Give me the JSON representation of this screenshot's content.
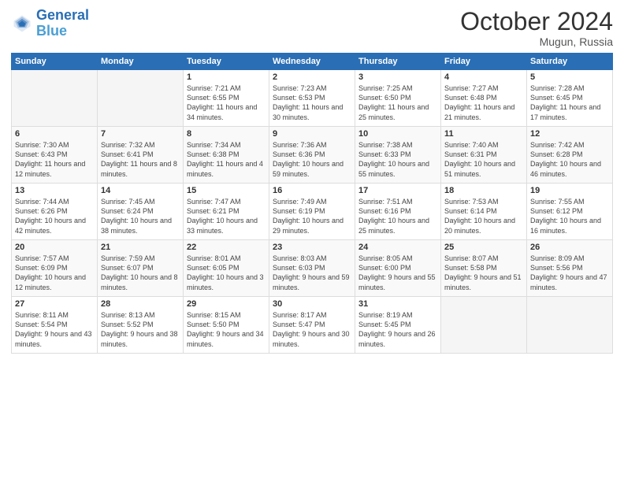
{
  "header": {
    "logo_line1": "General",
    "logo_line2": "Blue",
    "month": "October 2024",
    "location": "Mugun, Russia"
  },
  "weekdays": [
    "Sunday",
    "Monday",
    "Tuesday",
    "Wednesday",
    "Thursday",
    "Friday",
    "Saturday"
  ],
  "weeks": [
    [
      {
        "day": "",
        "sunrise": "",
        "sunset": "",
        "daylight": ""
      },
      {
        "day": "",
        "sunrise": "",
        "sunset": "",
        "daylight": ""
      },
      {
        "day": "1",
        "sunrise": "Sunrise: 7:21 AM",
        "sunset": "Sunset: 6:55 PM",
        "daylight": "Daylight: 11 hours and 34 minutes."
      },
      {
        "day": "2",
        "sunrise": "Sunrise: 7:23 AM",
        "sunset": "Sunset: 6:53 PM",
        "daylight": "Daylight: 11 hours and 30 minutes."
      },
      {
        "day": "3",
        "sunrise": "Sunrise: 7:25 AM",
        "sunset": "Sunset: 6:50 PM",
        "daylight": "Daylight: 11 hours and 25 minutes."
      },
      {
        "day": "4",
        "sunrise": "Sunrise: 7:27 AM",
        "sunset": "Sunset: 6:48 PM",
        "daylight": "Daylight: 11 hours and 21 minutes."
      },
      {
        "day": "5",
        "sunrise": "Sunrise: 7:28 AM",
        "sunset": "Sunset: 6:45 PM",
        "daylight": "Daylight: 11 hours and 17 minutes."
      }
    ],
    [
      {
        "day": "6",
        "sunrise": "Sunrise: 7:30 AM",
        "sunset": "Sunset: 6:43 PM",
        "daylight": "Daylight: 11 hours and 12 minutes."
      },
      {
        "day": "7",
        "sunrise": "Sunrise: 7:32 AM",
        "sunset": "Sunset: 6:41 PM",
        "daylight": "Daylight: 11 hours and 8 minutes."
      },
      {
        "day": "8",
        "sunrise": "Sunrise: 7:34 AM",
        "sunset": "Sunset: 6:38 PM",
        "daylight": "Daylight: 11 hours and 4 minutes."
      },
      {
        "day": "9",
        "sunrise": "Sunrise: 7:36 AM",
        "sunset": "Sunset: 6:36 PM",
        "daylight": "Daylight: 10 hours and 59 minutes."
      },
      {
        "day": "10",
        "sunrise": "Sunrise: 7:38 AM",
        "sunset": "Sunset: 6:33 PM",
        "daylight": "Daylight: 10 hours and 55 minutes."
      },
      {
        "day": "11",
        "sunrise": "Sunrise: 7:40 AM",
        "sunset": "Sunset: 6:31 PM",
        "daylight": "Daylight: 10 hours and 51 minutes."
      },
      {
        "day": "12",
        "sunrise": "Sunrise: 7:42 AM",
        "sunset": "Sunset: 6:28 PM",
        "daylight": "Daylight: 10 hours and 46 minutes."
      }
    ],
    [
      {
        "day": "13",
        "sunrise": "Sunrise: 7:44 AM",
        "sunset": "Sunset: 6:26 PM",
        "daylight": "Daylight: 10 hours and 42 minutes."
      },
      {
        "day": "14",
        "sunrise": "Sunrise: 7:45 AM",
        "sunset": "Sunset: 6:24 PM",
        "daylight": "Daylight: 10 hours and 38 minutes."
      },
      {
        "day": "15",
        "sunrise": "Sunrise: 7:47 AM",
        "sunset": "Sunset: 6:21 PM",
        "daylight": "Daylight: 10 hours and 33 minutes."
      },
      {
        "day": "16",
        "sunrise": "Sunrise: 7:49 AM",
        "sunset": "Sunset: 6:19 PM",
        "daylight": "Daylight: 10 hours and 29 minutes."
      },
      {
        "day": "17",
        "sunrise": "Sunrise: 7:51 AM",
        "sunset": "Sunset: 6:16 PM",
        "daylight": "Daylight: 10 hours and 25 minutes."
      },
      {
        "day": "18",
        "sunrise": "Sunrise: 7:53 AM",
        "sunset": "Sunset: 6:14 PM",
        "daylight": "Daylight: 10 hours and 20 minutes."
      },
      {
        "day": "19",
        "sunrise": "Sunrise: 7:55 AM",
        "sunset": "Sunset: 6:12 PM",
        "daylight": "Daylight: 10 hours and 16 minutes."
      }
    ],
    [
      {
        "day": "20",
        "sunrise": "Sunrise: 7:57 AM",
        "sunset": "Sunset: 6:09 PM",
        "daylight": "Daylight: 10 hours and 12 minutes."
      },
      {
        "day": "21",
        "sunrise": "Sunrise: 7:59 AM",
        "sunset": "Sunset: 6:07 PM",
        "daylight": "Daylight: 10 hours and 8 minutes."
      },
      {
        "day": "22",
        "sunrise": "Sunrise: 8:01 AM",
        "sunset": "Sunset: 6:05 PM",
        "daylight": "Daylight: 10 hours and 3 minutes."
      },
      {
        "day": "23",
        "sunrise": "Sunrise: 8:03 AM",
        "sunset": "Sunset: 6:03 PM",
        "daylight": "Daylight: 9 hours and 59 minutes."
      },
      {
        "day": "24",
        "sunrise": "Sunrise: 8:05 AM",
        "sunset": "Sunset: 6:00 PM",
        "daylight": "Daylight: 9 hours and 55 minutes."
      },
      {
        "day": "25",
        "sunrise": "Sunrise: 8:07 AM",
        "sunset": "Sunset: 5:58 PM",
        "daylight": "Daylight: 9 hours and 51 minutes."
      },
      {
        "day": "26",
        "sunrise": "Sunrise: 8:09 AM",
        "sunset": "Sunset: 5:56 PM",
        "daylight": "Daylight: 9 hours and 47 minutes."
      }
    ],
    [
      {
        "day": "27",
        "sunrise": "Sunrise: 8:11 AM",
        "sunset": "Sunset: 5:54 PM",
        "daylight": "Daylight: 9 hours and 43 minutes."
      },
      {
        "day": "28",
        "sunrise": "Sunrise: 8:13 AM",
        "sunset": "Sunset: 5:52 PM",
        "daylight": "Daylight: 9 hours and 38 minutes."
      },
      {
        "day": "29",
        "sunrise": "Sunrise: 8:15 AM",
        "sunset": "Sunset: 5:50 PM",
        "daylight": "Daylight: 9 hours and 34 minutes."
      },
      {
        "day": "30",
        "sunrise": "Sunrise: 8:17 AM",
        "sunset": "Sunset: 5:47 PM",
        "daylight": "Daylight: 9 hours and 30 minutes."
      },
      {
        "day": "31",
        "sunrise": "Sunrise: 8:19 AM",
        "sunset": "Sunset: 5:45 PM",
        "daylight": "Daylight: 9 hours and 26 minutes."
      },
      {
        "day": "",
        "sunrise": "",
        "sunset": "",
        "daylight": ""
      },
      {
        "day": "",
        "sunrise": "",
        "sunset": "",
        "daylight": ""
      }
    ]
  ]
}
